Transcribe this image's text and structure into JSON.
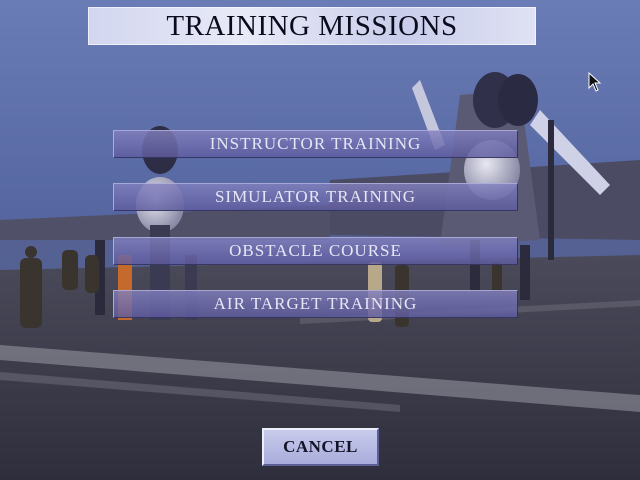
{
  "title": "TRAINING MISSIONS",
  "menu": {
    "items": [
      {
        "label": "INSTRUCTOR TRAINING"
      },
      {
        "label": "SIMULATOR TRAINING"
      },
      {
        "label": "OBSTACLE COURSE"
      },
      {
        "label": "AIR TARGET TRAINING"
      }
    ]
  },
  "cancel_label": "CANCEL",
  "colors": {
    "sky": "#4d5d95",
    "deck": "#3a3a4e",
    "button": "#7b78b8",
    "title_plate": "#d8dbf1"
  }
}
